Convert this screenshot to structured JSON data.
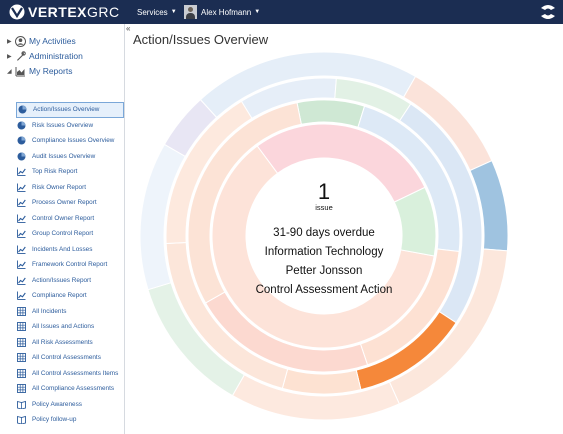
{
  "header": {
    "brand_bold": "VERTEX",
    "brand_light": "GRC",
    "services_label": "Services",
    "user_name": "Alex Hofmann"
  },
  "sidebar": {
    "collapse_glyph": "«",
    "sections": [
      {
        "label": "My Activities",
        "icon": "user-circle-icon"
      },
      {
        "label": "Administration",
        "icon": "wrench-icon"
      },
      {
        "label": "My Reports",
        "icon": "area-chart-icon"
      }
    ],
    "reports": [
      {
        "label": "Action/Issues Overview",
        "icon": "pie-chart-icon",
        "active": true
      },
      {
        "label": "Risk Issues Overview",
        "icon": "pie-chart-icon"
      },
      {
        "label": "Compliance Issues Overview",
        "icon": "pie-chart-icon"
      },
      {
        "label": "Audit Issues Overview",
        "icon": "pie-chart-icon"
      },
      {
        "label": "Top Risk Report",
        "icon": "line-chart-icon"
      },
      {
        "label": "Risk Owner Report",
        "icon": "line-chart-icon"
      },
      {
        "label": "Process Owner Report",
        "icon": "line-chart-icon"
      },
      {
        "label": "Control Owner Report",
        "icon": "line-chart-icon"
      },
      {
        "label": "Group Control Report",
        "icon": "line-chart-icon"
      },
      {
        "label": "Incidents And Losses",
        "icon": "line-chart-icon"
      },
      {
        "label": "Framework Control Report",
        "icon": "line-chart-icon"
      },
      {
        "label": "Action/Issues Report",
        "icon": "line-chart-icon"
      },
      {
        "label": "Compliance Report",
        "icon": "line-chart-icon"
      },
      {
        "label": "All Incidents",
        "icon": "table-icon"
      },
      {
        "label": "All Issues and Actions",
        "icon": "table-icon"
      },
      {
        "label": "All Risk Assessments",
        "icon": "table-icon"
      },
      {
        "label": "All Control Assessments",
        "icon": "table-icon"
      },
      {
        "label": "All Control Assessments Items",
        "icon": "table-icon"
      },
      {
        "label": "All Compliance Assessments",
        "icon": "table-icon"
      },
      {
        "label": "Policy Awareness",
        "icon": "book-icon"
      },
      {
        "label": "Policy follow-up",
        "icon": "book-icon"
      }
    ]
  },
  "main": {
    "title": "Action/Issues Overview",
    "center": {
      "count": "1",
      "unit": "issue",
      "line1": "31-90 days overdue",
      "line2": "Information Technology",
      "line3": "Petter Jonsson",
      "line4": "Control Assessment Action"
    }
  },
  "colors": {
    "header_bg": "#1b2d52",
    "link": "#2c5c9c",
    "highlight_orange": "#f5883a",
    "highlight_blue": "#9fc3e0"
  },
  "chart_data": {
    "type": "sunburst",
    "hovered_path": [
      "31-90 days overdue",
      "Information Technology",
      "Petter Jonsson",
      "Control Assessment Action"
    ],
    "hovered_value": 1,
    "rings": [
      {
        "segments": [
          {
            "share": 0.62,
            "color": "#fde3d9"
          },
          {
            "share": 0.28,
            "color": "#fbd6dc"
          },
          {
            "share": 0.1,
            "color": "#d9f0dc"
          }
        ]
      },
      {
        "segments": [
          {
            "share": 0.08,
            "color": "#cfe8d4"
          },
          {
            "share": 0.22,
            "color": "#dde9f6"
          },
          {
            "share": 0.18,
            "color": "#fde1d3"
          },
          {
            "share": 0.22,
            "color": "#fcd9d0"
          },
          {
            "share": 0.3,
            "color": "#fce3d6"
          }
        ]
      },
      {
        "segments": [
          {
            "share": 0.1,
            "color": "#e6eef8"
          },
          {
            "share": 0.08,
            "color": "#e2f1e5"
          },
          {
            "share": 0.25,
            "color": "#dbe7f5"
          },
          {
            "share": 0.12,
            "color": "#f5883a"
          },
          {
            "share": 0.08,
            "color": "#fde2d2"
          },
          {
            "share": 0.2,
            "color": "#fce6da"
          },
          {
            "share": 0.17,
            "color": "#fde9de"
          }
        ]
      },
      {
        "segments": [
          {
            "share": 0.05,
            "color": "#e8e6f4"
          },
          {
            "share": 0.2,
            "color": "#e5eef8"
          },
          {
            "share": 0.1,
            "color": "#fbe3da"
          },
          {
            "share": 0.08,
            "color": "#9fc3e0"
          },
          {
            "share": 0.17,
            "color": "#fce7dc"
          },
          {
            "share": 0.15,
            "color": "#fde9df"
          },
          {
            "share": 0.12,
            "color": "#e4f2e7"
          },
          {
            "share": 0.13,
            "color": "#eef4fb"
          }
        ]
      }
    ]
  }
}
